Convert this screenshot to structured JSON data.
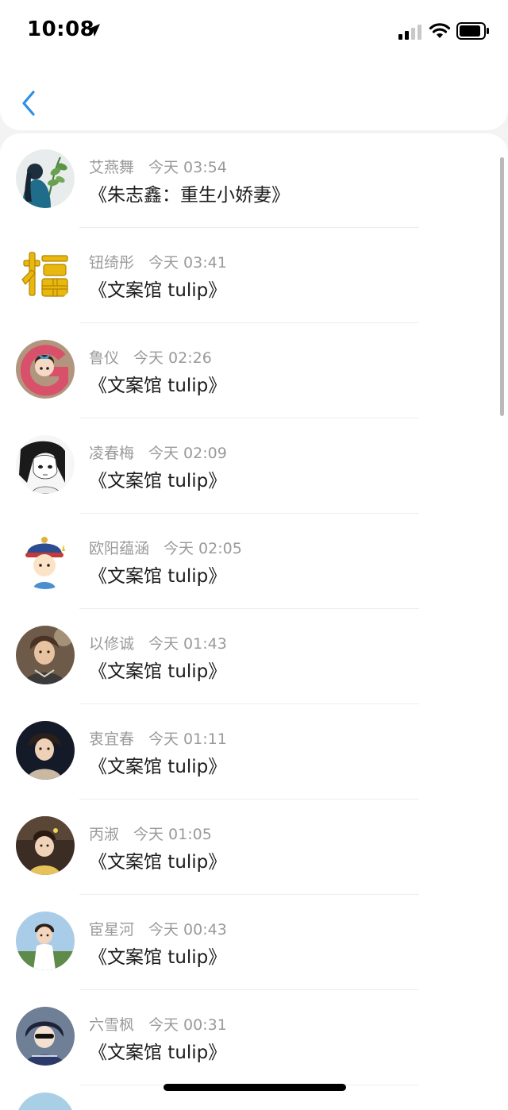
{
  "status_bar": {
    "time": "10:08",
    "icons": [
      "location-arrow-icon",
      "cellular-signal-icon",
      "wifi-icon",
      "battery-icon"
    ]
  },
  "nav": {
    "back_icon": "chevron-left-icon",
    "accent_color": "#2f8ee6"
  },
  "comments": [
    {
      "name": "艾燕舞",
      "time": "今天 03:54",
      "text": "《朱志鑫：重生小娇妻》",
      "avatar": "girl-with-plant"
    },
    {
      "name": "钮绮彤",
      "time": "今天 03:41",
      "text": "《文案馆 tulip》",
      "avatar": "fu-character"
    },
    {
      "name": "鲁仪",
      "time": "今天 02:26",
      "text": "《文案馆 tulip》",
      "avatar": "cartoon-girl-letter-g"
    },
    {
      "name": "凌春梅",
      "time": "今天 02:09",
      "text": "《文案馆 tulip》",
      "avatar": "manga-girl"
    },
    {
      "name": "欧阳蕴涵",
      "time": "今天 02:05",
      "text": "《文案馆 tulip》",
      "avatar": "cartoon-boy-hat"
    },
    {
      "name": "以修诚",
      "time": "今天 01:43",
      "text": "《文案馆 tulip》",
      "avatar": "young-man-photo"
    },
    {
      "name": "衷宜春",
      "time": "今天 01:11",
      "text": "《文案馆 tulip》",
      "avatar": "boy-dark-background"
    },
    {
      "name": "丙淑",
      "time": "今天 01:05",
      "text": "《文案馆 tulip》",
      "avatar": "girl-photo"
    },
    {
      "name": "宦星河",
      "time": "今天 00:43",
      "text": "《文案馆 tulip》",
      "avatar": "child-outdoors"
    },
    {
      "name": "六雪枫",
      "time": "今天 00:31",
      "text": "《文案馆 tulip》",
      "avatar": "anime-character-dark"
    }
  ]
}
